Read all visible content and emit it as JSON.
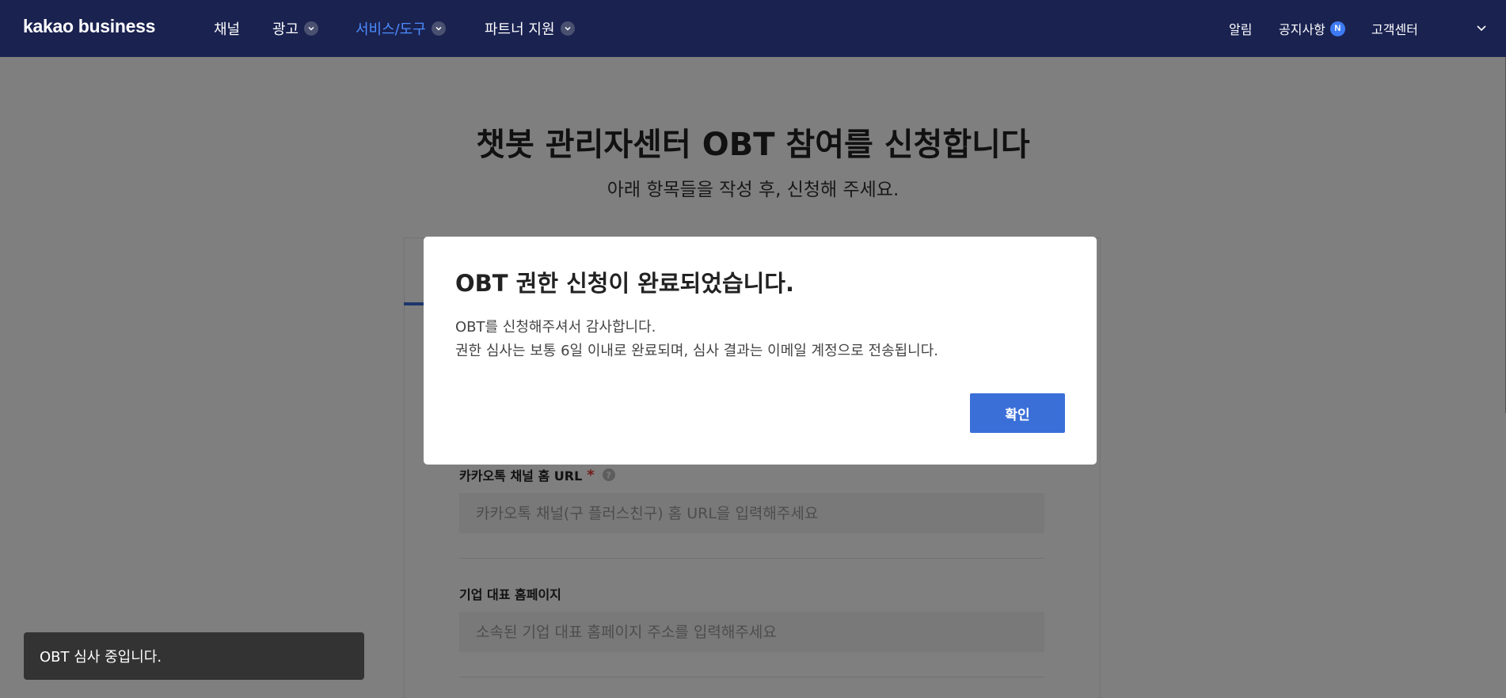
{
  "header": {
    "logo": "kakao business",
    "nav": [
      {
        "label": "채널",
        "has_dropdown": false,
        "active": false
      },
      {
        "label": "광고",
        "has_dropdown": true,
        "active": false
      },
      {
        "label": "서비스/도구",
        "has_dropdown": true,
        "active": true
      },
      {
        "label": "파트너 지원",
        "has_dropdown": true,
        "active": false
      }
    ],
    "notifications_label": "알림",
    "notices_label": "공지사항",
    "notices_badge": "N",
    "support_label": "고객센터"
  },
  "page": {
    "title": "챗봇 관리자센터 OBT 참여를 신청합니다",
    "subtitle": "아래 항목들을 작성 후, 신청해 주세요."
  },
  "form": {
    "channel_url": {
      "label": "카카오톡 채널 홈 URL",
      "required_mark": "*",
      "help": "?",
      "placeholder": "카카오톡 채널(구 플러스친구) 홈 URL을 입력해주세요"
    },
    "company_homepage": {
      "label": "기업 대표 홈페이지",
      "placeholder": "소속된 기업 대표 홈페이지 주소를 입력해주세요"
    }
  },
  "modal": {
    "title": "OBT 권한 신청이 완료되었습니다.",
    "line1": "OBT를 신청해주셔서 감사합니다.",
    "line2": "권한 심사는 보통 6일 이내로 완료되며, 심사 결과는 이메일 계정으로 전송됩니다.",
    "confirm_label": "확인"
  },
  "toast": {
    "message": "OBT 심사 중입니다."
  },
  "colors": {
    "nav_bg": "#1a2250",
    "nav_active": "#4c8cff",
    "primary": "#3a6fd8",
    "required": "#e53935",
    "toast_bg": "#333333"
  }
}
